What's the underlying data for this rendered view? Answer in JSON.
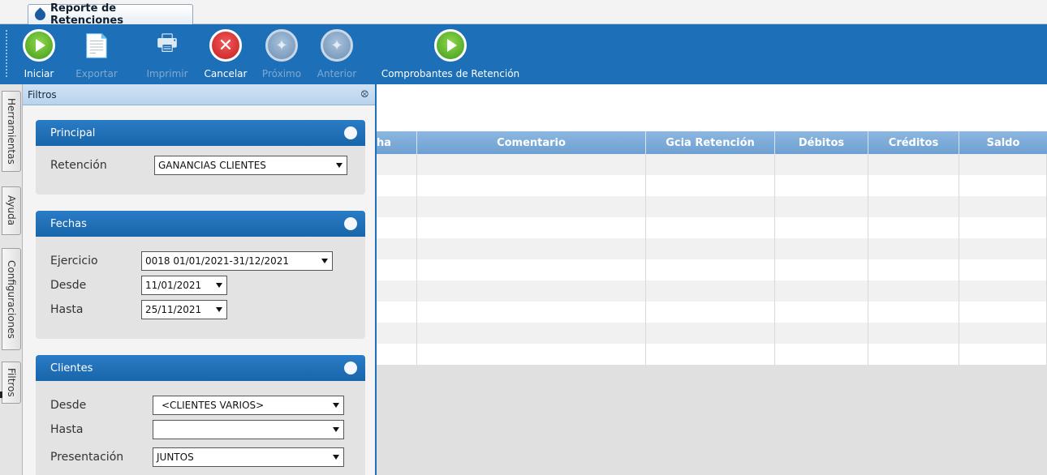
{
  "tab": {
    "title": "Reporte de Retenciones"
  },
  "toolbar": {
    "buttons": [
      {
        "label": "Iniciar",
        "icon": "play-icon",
        "enabled": true
      },
      {
        "label": "Exportar",
        "icon": "export-icon",
        "enabled": false
      },
      {
        "label": "Imprimir",
        "icon": "printer-icon",
        "enabled": false
      },
      {
        "label": "Cancelar",
        "icon": "cancel-icon",
        "enabled": true
      },
      {
        "label": "Próximo",
        "icon": "next-icon",
        "enabled": false
      },
      {
        "label": "Anterior",
        "icon": "previous-icon",
        "enabled": false
      },
      {
        "label": "Comprobantes de Retención",
        "icon": "play-icon",
        "enabled": true
      }
    ]
  },
  "sidetabs": [
    "Herramientas",
    "Ayuda",
    "Configuraciones",
    "Filtros"
  ],
  "filters": {
    "title": "Filtros",
    "principal": {
      "title": "Principal",
      "retencion_label": "Retención",
      "retencion_value": "GANANCIAS CLIENTES"
    },
    "fechas": {
      "title": "Fechas",
      "ejercicio_label": "Ejercicio",
      "ejercicio_value": "0018 01/01/2021-31/12/2021",
      "desde_label": "Desde",
      "desde_value": "11/01/2021",
      "hasta_label": "Hasta",
      "hasta_value": "25/11/2021"
    },
    "clientes": {
      "title": "Clientes",
      "desde_label": "Desde",
      "desde_value": "<CLIENTES VARIOS>",
      "hasta_label": "Hasta",
      "hasta_value": "",
      "presentacion_label": "Presentación",
      "presentacion_value": "JUNTOS"
    }
  },
  "grid": {
    "columns": [
      "ha",
      "Comentario",
      "Gcia Retención",
      "Débitos",
      "Créditos",
      "Saldo"
    ],
    "row_count": 10
  },
  "colors": {
    "toolbar": "#1d70b8",
    "group_header": "#1d6fb6",
    "grid_header": "#7aa9d6"
  }
}
